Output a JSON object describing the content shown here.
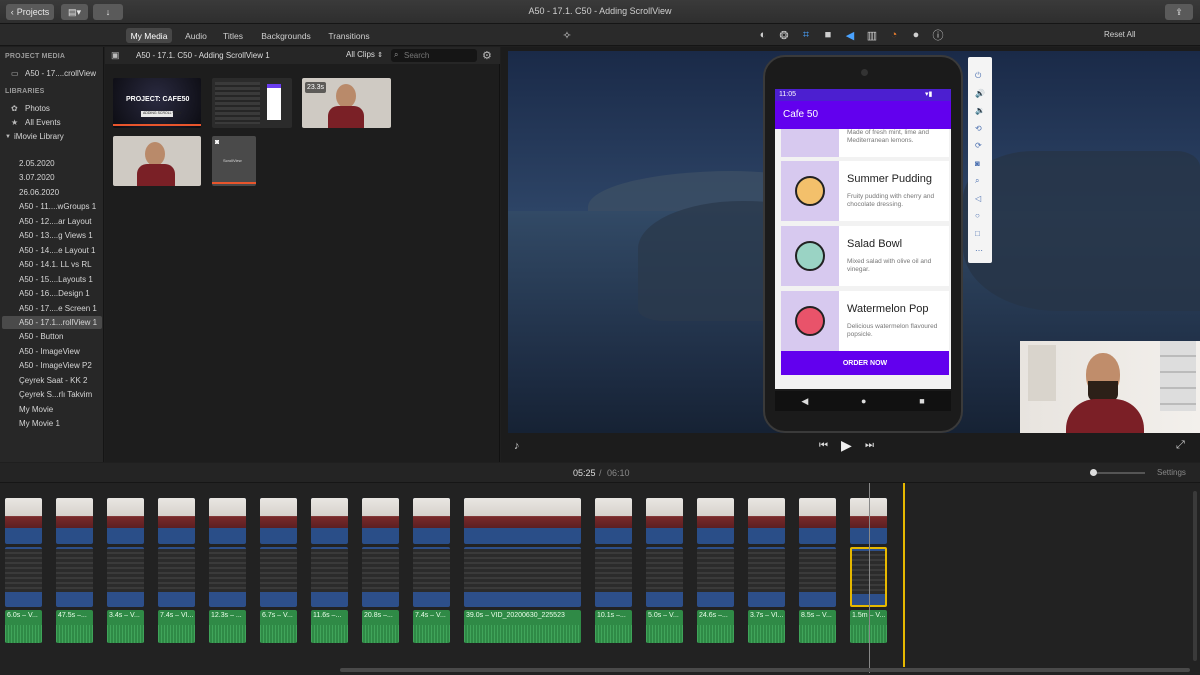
{
  "window": {
    "title": "A50 - 17.1. C50 - Adding ScrollView",
    "projects_label": "Projects",
    "reset_all": "Reset All"
  },
  "tabs": [
    {
      "label": "My Media",
      "active": true
    },
    {
      "label": "Audio",
      "active": false
    },
    {
      "label": "Titles",
      "active": false
    },
    {
      "label": "Backgrounds",
      "active": false
    },
    {
      "label": "Transitions",
      "active": false
    }
  ],
  "sidebar": {
    "project_media_header": "PROJECT MEDIA",
    "project_item": "A50 - 17....crollView",
    "libraries_header": "LIBRARIES",
    "photos": "Photos",
    "all_events": "All Events",
    "library": "iMovie Library",
    "events": [
      "2.05.2020",
      "3.07.2020",
      "26.06.2020",
      "A50 - 11....wGroups 1",
      "A50 - 12....ar Layout",
      "A50 - 13....g Views 1",
      "A50 - 14....e Layout 1",
      "A50 - 14.1. LL vs RL",
      "A50 - 15....Layouts 1",
      "A50 - 16....Design 1",
      "A50 - 17....e Screen 1",
      "A50 - 17.1...rollView 1",
      "A50 - Button",
      "A50 - ImageView",
      "A50 - ImageView P2",
      "Çeyrek Saat - KK 2",
      "Çeyrek S...rlı Takvim",
      "My Movie",
      "My Movie 1"
    ],
    "selected_index": 11
  },
  "browser": {
    "title": "A50 - 17.1. C50 - Adding ScrollView 1",
    "filter": "All Clips",
    "search_placeholder": "Search",
    "thumb_cafe_title": "PROJECT: CAFE50",
    "thumb_cafe_sub": "ADDING SCROLL VIEW",
    "thumb_duration": "23.3s",
    "thumb_scroll_label": "ScrollView"
  },
  "phone": {
    "time": "11:05",
    "app_title": "Cafe 50",
    "cut_text": "Made of fresh mint, lime and Mediterranean lemons.",
    "items": [
      {
        "name": "Summer Pudding",
        "desc": "Fruity pudding with cherry and chocolate dressing."
      },
      {
        "name": "Salad Bowl",
        "desc": "Mixed salad with olive oil and vinegar."
      },
      {
        "name": "Watermelon Pop",
        "desc": "Delicious watermelon flavoured popsicle."
      }
    ],
    "order_button": "ORDER NOW"
  },
  "playback": {
    "current": "05:25",
    "separator": "/",
    "total": "06:10"
  },
  "timeline": {
    "settings_label": "Settings",
    "clips": [
      "6.0s – V...",
      "47.5s –...",
      "3.4s – V...",
      "7.4s – VI...",
      "12.3s – ...",
      "6.7s – V...",
      "11.6s –...",
      "20.8s –...",
      "7.4s – V...",
      "39.0s – VID_20200630_225523",
      "10.1s –...",
      "5.0s – V...",
      "24.6s –...",
      "3.7s – VI...",
      "8.5s – V...",
      "1.5m – V..."
    ]
  },
  "colors": {
    "accent_purple": "#6200ee",
    "audio_green": "#2f8a46",
    "video_blue": "#2a4e88",
    "playhead": "#e6b800"
  }
}
